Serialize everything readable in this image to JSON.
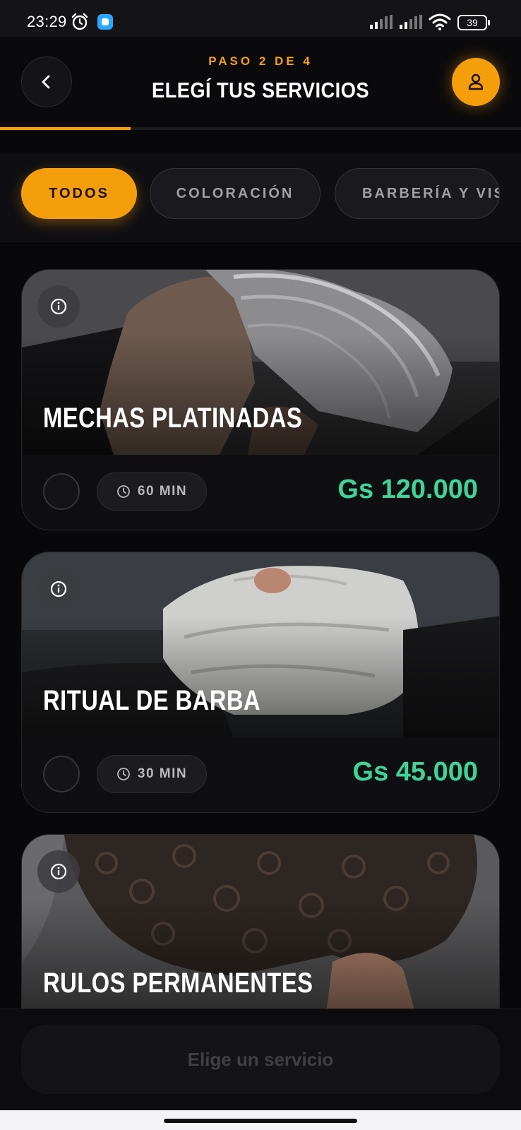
{
  "status_bar": {
    "time": "23:29",
    "icons": [
      "alarm-icon",
      "app-notification-icon",
      "signal-icon",
      "signal-icon",
      "wifi-icon"
    ],
    "battery": "39"
  },
  "header": {
    "step": "PASO 2 DE 4",
    "title": "ELEGÍ TUS SERVICIOS",
    "back_icon": "chevron-left-icon",
    "profile_icon": "user-icon",
    "progress": 0.25,
    "accent": "#f59e0b"
  },
  "filters": [
    {
      "label": "TODOS",
      "active": true
    },
    {
      "label": "COLORACIÓN",
      "active": false
    },
    {
      "label": "BARBERÍA Y VIS",
      "active": false
    }
  ],
  "services": [
    {
      "title": "MECHAS PLATINADAS",
      "duration": "60 MIN",
      "price": "Gs 120.000",
      "info_icon": "info-icon",
      "clock_icon": "clock-icon"
    },
    {
      "title": "RITUAL DE BARBA",
      "duration": "30 MIN",
      "price": "Gs 45.000",
      "info_icon": "info-icon",
      "clock_icon": "clock-icon"
    },
    {
      "title": "RULOS PERMANENTES",
      "info_icon": "info-icon"
    }
  ],
  "price_color": "#3fd39a",
  "cta": {
    "label": "Elige un servicio"
  }
}
